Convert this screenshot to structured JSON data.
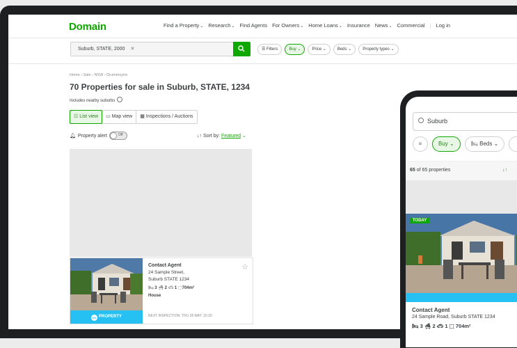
{
  "nav": {
    "logo": "Domain",
    "links": [
      {
        "label": "Find a Property",
        "dropdown": true
      },
      {
        "label": "Research",
        "dropdown": true
      },
      {
        "label": "Find Agents",
        "dropdown": false
      },
      {
        "label": "For Owners",
        "dropdown": true
      },
      {
        "label": "Home Loans",
        "dropdown": true
      },
      {
        "label": "Insurance",
        "dropdown": false
      },
      {
        "label": "News",
        "dropdown": true
      },
      {
        "label": "Commercial",
        "dropdown": false
      },
      {
        "label": "Log in",
        "dropdown": false
      }
    ]
  },
  "search": {
    "chip": "Suburb, STATE, 2000",
    "filters": [
      "Filters",
      "Buy",
      "Price",
      "Beds",
      "Property types"
    ]
  },
  "breadcrumb": "Home › Sale › NSW › Drummoyne",
  "page_title": "70 Properties for sale in Suburb, STATE, 1234",
  "nearby_label": "Includes nearby suburbs",
  "view_tabs": [
    "List view",
    "Map view",
    "Inspections / Auctions"
  ],
  "alert": {
    "label": "Property alert",
    "toggle": "Off"
  },
  "sort": {
    "label": "Sort by:",
    "value": "Featured"
  },
  "listing": {
    "price": "Contact Agent",
    "address_line1": "24 Sample Street,",
    "address_line2": "Suburb STATE 1234",
    "beds": "3",
    "baths": "2",
    "parking": "1",
    "land": "704m²",
    "type": "House",
    "agency": "PROPERTY",
    "agency_badge": "DO",
    "inspection": "NEXT INSPECTION: THU 28 MAY, 15:30"
  },
  "phone": {
    "search_value": "Suburb",
    "filters": [
      "Buy",
      "Beds"
    ],
    "count_number": "65",
    "count_text": "of 65 properties",
    "tag": "TODAY",
    "price": "Contact Agent",
    "address": "24 Sample Road, Suburb STATE 1234",
    "beds": "3",
    "baths": "2",
    "parking": "1",
    "land": "704m²"
  },
  "colors": {
    "brand_green": "#0ea800",
    "agency_blue": "#26c0f2"
  }
}
